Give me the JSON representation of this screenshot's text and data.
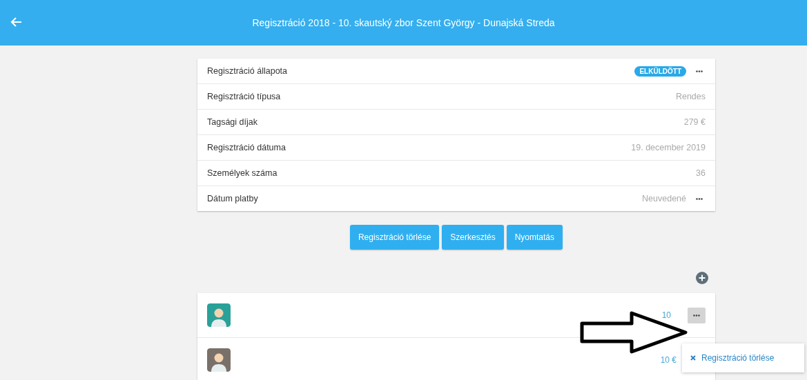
{
  "header": {
    "title": "Regisztráció 2018 - 10. skautský zbor Szent György - Dunajská Streda"
  },
  "details": [
    {
      "label": "Regisztráció állapota",
      "kind": "badge",
      "value": "ELKÜLDÖTT"
    },
    {
      "label": "Regisztráció típusa",
      "kind": "text",
      "value": "Rendes"
    },
    {
      "label": "Tagsági díjak",
      "kind": "text",
      "value": "279 €"
    },
    {
      "label": "Regisztráció dátuma",
      "kind": "text",
      "value": "19. december 2019"
    },
    {
      "label": "Személyek száma",
      "kind": "text",
      "value": "36"
    },
    {
      "label": "Dátum platby",
      "kind": "menu",
      "value": "Neuvedené"
    }
  ],
  "actions": [
    "Regisztráció törlése",
    "Szerkesztés",
    "Nyomtatás"
  ],
  "people": [
    {
      "color": "#2aa198",
      "price": "10",
      "menu_open": true
    },
    {
      "color": "#7a706a",
      "price": "10 €",
      "menu_open": false
    }
  ],
  "menu": {
    "items": [
      "Regisztráció törlése"
    ]
  }
}
